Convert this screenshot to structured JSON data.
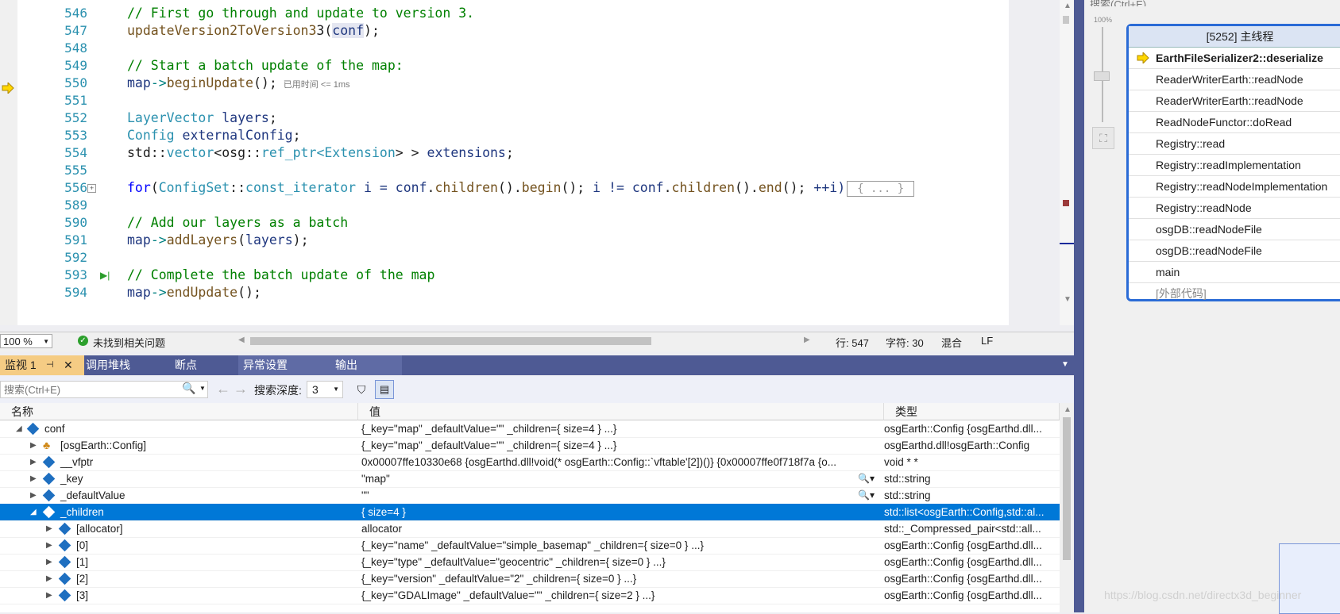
{
  "editor": {
    "line_numbers": [
      "546",
      "547",
      "548",
      "549",
      "550",
      "551",
      "552",
      "553",
      "554",
      "555",
      "556",
      "589",
      "590",
      "591",
      "592",
      "593",
      "594"
    ],
    "code": {
      "l546": "// First go through and update to version 3.",
      "l547_fn": "updateVersion2ToVersion3",
      "l547_arg": "conf",
      "l549": "// Start a batch update of the map:",
      "l550_var": "map",
      "l550_fn": "beginUpdate",
      "l550_elapsed": "已用时间 <= 1ms",
      "l552_type": "LayerVector",
      "l552_var": "layers",
      "l553_type": "Config",
      "l553_var": "externalConfig",
      "l554_a": "std::",
      "l554_b": "vector",
      "l554_c": "<osg::",
      "l554_d": "ref_ptr",
      "l554_e": "<",
      "l554_f": "Extension",
      "l554_g": "> > ",
      "l554_h": "extensions",
      "l556_kw": "for",
      "l556_type": "ConfigSet",
      "l556_rest1": "::",
      "l556_iter": "const_iterator",
      "l556_i": " i = ",
      "l556_conf": "conf",
      "l556_children": "children",
      "l556_begin": "begin",
      "l556_mid": " i != ",
      "l556_end": "end",
      "l556_inc": " ++i)",
      "l556_collapsed": "{ ... }",
      "l590": "// Add our layers as a batch",
      "l591_fn": "addLayers",
      "l591_arg": "layers",
      "l593": "// Complete the batch update of the map",
      "l594_fn": "endUpdate"
    }
  },
  "statusbar": {
    "zoom": "100 %",
    "issues": "未找到相关问题",
    "line": "行: 547",
    "char": "字符: 30",
    "mode": "混合",
    "eol": "LF"
  },
  "right_pane": {
    "search_hint": "搜索(Ctrl+E)",
    "zoom_pct": "100%"
  },
  "callstack": {
    "title": "[5252] 主线程",
    "items": [
      "EarthFileSerializer2::deserialize",
      "ReaderWriterEarth::readNode",
      "ReaderWriterEarth::readNode",
      "ReadNodeFunctor::doRead",
      "Registry::read",
      "Registry::readImplementation",
      "Registry::readNodeImplementation",
      "Registry::readNode",
      "osgDB::readNodeFile",
      "osgDB::readNodeFile",
      "main",
      "[外部代码]"
    ]
  },
  "tabs": [
    "监视 1",
    "调用堆栈",
    "断点",
    "异常设置",
    "输出"
  ],
  "toolbar": {
    "search_placeholder": "搜索(Ctrl+E)",
    "depth_label": "搜索深度:",
    "depth_value": "3"
  },
  "grid": {
    "headers": [
      "名称",
      "值",
      "类型"
    ],
    "rows": [
      {
        "name": "conf",
        "value": "{_key=\"map\" _defaultValue=\"\" _children={ size=4 } ...}",
        "type": "osgEarth::Config {osgEarthd.dll..."
      },
      {
        "name": "[osgEarth::Config]",
        "value": "{_key=\"map\" _defaultValue=\"\" _children={ size=4 } ...}",
        "type": "osgEarthd.dll!osgEarth::Config"
      },
      {
        "name": "__vfptr",
        "value": "0x00007ffe10330e68 {osgEarthd.dll!void(* osgEarth::Config::`vftable'[2])()} {0x00007ffe0f718f7a {o...",
        "type": "void * *"
      },
      {
        "name": "_key",
        "value": "\"map\"",
        "type": "std::string"
      },
      {
        "name": "_defaultValue",
        "value": "\"\"",
        "type": "std::string"
      },
      {
        "name": "_children",
        "value": "{ size=4 }",
        "type": "std::list<osgEarth::Config,std::al..."
      },
      {
        "name": "[allocator]",
        "value": "allocator",
        "type": "std::_Compressed_pair<std::all..."
      },
      {
        "name": "[0]",
        "value": "{_key=\"name\" _defaultValue=\"simple_basemap\" _children={ size=0 } ...}",
        "type": "osgEarth::Config {osgEarthd.dll..."
      },
      {
        "name": "[1]",
        "value": "{_key=\"type\" _defaultValue=\"geocentric\" _children={ size=0 } ...}",
        "type": "osgEarth::Config {osgEarthd.dll..."
      },
      {
        "name": "[2]",
        "value": "{_key=\"version\" _defaultValue=\"2\" _children={ size=0 } ...}",
        "type": "osgEarth::Config {osgEarthd.dll..."
      },
      {
        "name": "[3]",
        "value": "{_key=\"GDALImage\" _defaultValue=\"\" _children={ size=2 } ...}",
        "type": "osgEarth::Config {osgEarthd.dll..."
      }
    ]
  },
  "watermark": "https://blog.csdn.net/directx3d_beginner"
}
